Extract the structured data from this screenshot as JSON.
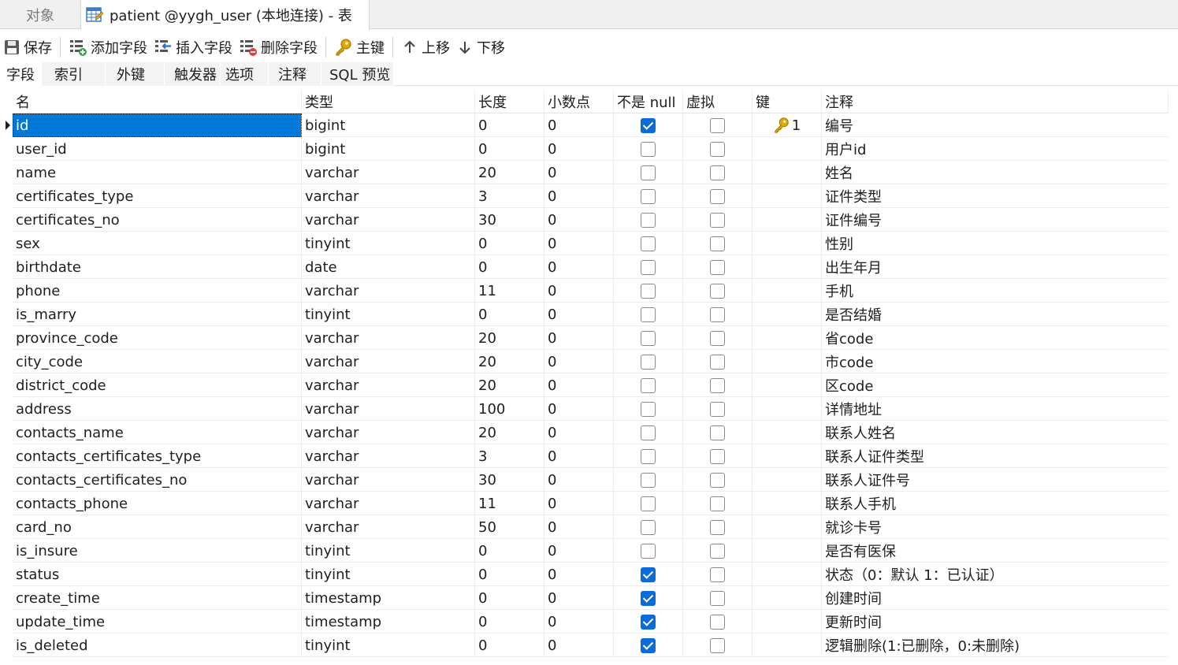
{
  "tabs": {
    "objects_label": "对象",
    "active_label": "patient @yygh_user (本地连接) - 表"
  },
  "toolbar": {
    "save": "保存",
    "add_field": "添加字段",
    "insert_field": "插入字段",
    "delete_field": "删除字段",
    "primary_key": "主键",
    "move_up": "上移",
    "move_down": "下移"
  },
  "subtabs": [
    "字段",
    "索引",
    "外键",
    "触发器",
    "选项",
    "注释",
    "SQL 预览"
  ],
  "columns": {
    "name": "名",
    "type": "类型",
    "length": "长度",
    "decimals": "小数点",
    "not_null": "不是 null",
    "virtual": "虚拟",
    "key": "键",
    "comment": "注释"
  },
  "fields": [
    {
      "name": "id",
      "type": "bigint",
      "length": "0",
      "decimals": "0",
      "not_null": true,
      "virtual": false,
      "key": "1",
      "comment": "编号"
    },
    {
      "name": "user_id",
      "type": "bigint",
      "length": "0",
      "decimals": "0",
      "not_null": false,
      "virtual": false,
      "key": "",
      "comment": "用户id"
    },
    {
      "name": "name",
      "type": "varchar",
      "length": "20",
      "decimals": "0",
      "not_null": false,
      "virtual": false,
      "key": "",
      "comment": "姓名"
    },
    {
      "name": "certificates_type",
      "type": "varchar",
      "length": "3",
      "decimals": "0",
      "not_null": false,
      "virtual": false,
      "key": "",
      "comment": "证件类型"
    },
    {
      "name": "certificates_no",
      "type": "varchar",
      "length": "30",
      "decimals": "0",
      "not_null": false,
      "virtual": false,
      "key": "",
      "comment": "证件编号"
    },
    {
      "name": "sex",
      "type": "tinyint",
      "length": "0",
      "decimals": "0",
      "not_null": false,
      "virtual": false,
      "key": "",
      "comment": "性别"
    },
    {
      "name": "birthdate",
      "type": "date",
      "length": "0",
      "decimals": "0",
      "not_null": false,
      "virtual": false,
      "key": "",
      "comment": "出生年月"
    },
    {
      "name": "phone",
      "type": "varchar",
      "length": "11",
      "decimals": "0",
      "not_null": false,
      "virtual": false,
      "key": "",
      "comment": "手机"
    },
    {
      "name": "is_marry",
      "type": "tinyint",
      "length": "0",
      "decimals": "0",
      "not_null": false,
      "virtual": false,
      "key": "",
      "comment": "是否结婚"
    },
    {
      "name": "province_code",
      "type": "varchar",
      "length": "20",
      "decimals": "0",
      "not_null": false,
      "virtual": false,
      "key": "",
      "comment": "省code"
    },
    {
      "name": "city_code",
      "type": "varchar",
      "length": "20",
      "decimals": "0",
      "not_null": false,
      "virtual": false,
      "key": "",
      "comment": "市code"
    },
    {
      "name": "district_code",
      "type": "varchar",
      "length": "20",
      "decimals": "0",
      "not_null": false,
      "virtual": false,
      "key": "",
      "comment": "区code"
    },
    {
      "name": "address",
      "type": "varchar",
      "length": "100",
      "decimals": "0",
      "not_null": false,
      "virtual": false,
      "key": "",
      "comment": "详情地址"
    },
    {
      "name": "contacts_name",
      "type": "varchar",
      "length": "20",
      "decimals": "0",
      "not_null": false,
      "virtual": false,
      "key": "",
      "comment": "联系人姓名"
    },
    {
      "name": "contacts_certificates_type",
      "type": "varchar",
      "length": "3",
      "decimals": "0",
      "not_null": false,
      "virtual": false,
      "key": "",
      "comment": "联系人证件类型"
    },
    {
      "name": "contacts_certificates_no",
      "type": "varchar",
      "length": "30",
      "decimals": "0",
      "not_null": false,
      "virtual": false,
      "key": "",
      "comment": "联系人证件号"
    },
    {
      "name": "contacts_phone",
      "type": "varchar",
      "length": "11",
      "decimals": "0",
      "not_null": false,
      "virtual": false,
      "key": "",
      "comment": "联系人手机"
    },
    {
      "name": "card_no",
      "type": "varchar",
      "length": "50",
      "decimals": "0",
      "not_null": false,
      "virtual": false,
      "key": "",
      "comment": "就诊卡号"
    },
    {
      "name": "is_insure",
      "type": "tinyint",
      "length": "0",
      "decimals": "0",
      "not_null": false,
      "virtual": false,
      "key": "",
      "comment": "是否有医保"
    },
    {
      "name": "status",
      "type": "tinyint",
      "length": "0",
      "decimals": "0",
      "not_null": true,
      "virtual": false,
      "key": "",
      "comment": "状态（0：默认 1：已认证）"
    },
    {
      "name": "create_time",
      "type": "timestamp",
      "length": "0",
      "decimals": "0",
      "not_null": true,
      "virtual": false,
      "key": "",
      "comment": "创建时间"
    },
    {
      "name": "update_time",
      "type": "timestamp",
      "length": "0",
      "decimals": "0",
      "not_null": true,
      "virtual": false,
      "key": "",
      "comment": "更新时间"
    },
    {
      "name": "is_deleted",
      "type": "tinyint",
      "length": "0",
      "decimals": "0",
      "not_null": true,
      "virtual": false,
      "key": "",
      "comment": "逻辑删除(1:已删除，0:未删除)"
    }
  ],
  "selected_row": 0,
  "colors": {
    "selection": "#0078d7",
    "checkbox_checked": "#0a6cd8",
    "key_icon": "#e0a800"
  }
}
